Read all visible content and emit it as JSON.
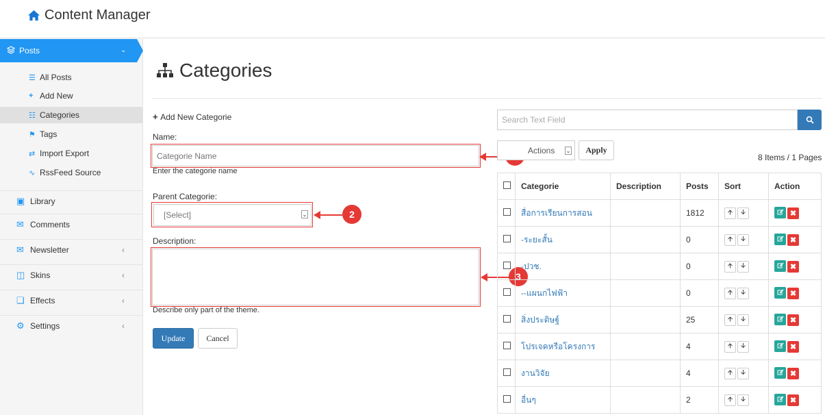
{
  "app": {
    "title": "Content Manager"
  },
  "sidebar": {
    "posts_label": "Posts",
    "sub_items": [
      {
        "label": "All Posts",
        "icon": "list-icon"
      },
      {
        "label": "Add New",
        "icon": "plus-icon"
      },
      {
        "label": "Categories",
        "icon": "sitemap-icon",
        "active": true
      },
      {
        "label": "Tags",
        "icon": "tags-icon"
      },
      {
        "label": "Import Export",
        "icon": "exchange-icon"
      },
      {
        "label": "RssFeed Source",
        "icon": "rss-icon"
      }
    ],
    "menus": [
      {
        "label": "Library",
        "icon": "image-icon"
      },
      {
        "label": "Comments",
        "icon": "comments-icon"
      },
      {
        "label": "Newsletter",
        "icon": "envelope-icon",
        "has_children": true
      },
      {
        "label": "Skins",
        "icon": "shirt-icon",
        "has_children": true
      },
      {
        "label": "Effects",
        "icon": "clone-icon",
        "has_children": true
      },
      {
        "label": "Settings",
        "icon": "cog-icon",
        "has_children": true
      }
    ]
  },
  "page": {
    "title": "Categories"
  },
  "form": {
    "add_new_label": "Add New Categorie",
    "name_label": "Name:",
    "name_placeholder": "Categorie Name",
    "name_help": "Enter the categorie name",
    "parent_label": "Parent Categorie:",
    "parent_value": "[Select]",
    "description_label": "Description:",
    "description_help": "Describe only part of the theme.",
    "update_label": "Update",
    "cancel_label": "Cancel"
  },
  "callouts": [
    "1",
    "2",
    "3"
  ],
  "list": {
    "search_placeholder": "Search Text Field",
    "bulk_actions": "Actions",
    "apply_label": "Apply",
    "pager_text": "8 Items / 1 Pages",
    "columns": [
      "Categorie",
      "Description",
      "Posts",
      "Sort",
      "Action"
    ],
    "rows": [
      {
        "name": "สื่อการเรียนการสอน",
        "description": "",
        "posts": "1812"
      },
      {
        "name": "-ระยะสั้น",
        "description": "",
        "posts": "0"
      },
      {
        "name": "-ปวช.",
        "description": "",
        "posts": "0"
      },
      {
        "name": "--แผนกไฟฟ้า",
        "description": "",
        "posts": "0"
      },
      {
        "name": "สิ่งประดิษฐ์",
        "description": "",
        "posts": "25"
      },
      {
        "name": "โปรเจคหรือโครงการ",
        "description": "",
        "posts": "4"
      },
      {
        "name": "งานวิจัย",
        "description": "",
        "posts": "4"
      },
      {
        "name": "อื่นๆ",
        "description": "",
        "posts": "2"
      }
    ]
  },
  "colors": {
    "primary": "#2196f3",
    "button": "#337ab7",
    "annotation": "#e53935",
    "edit": "#26a69a"
  }
}
